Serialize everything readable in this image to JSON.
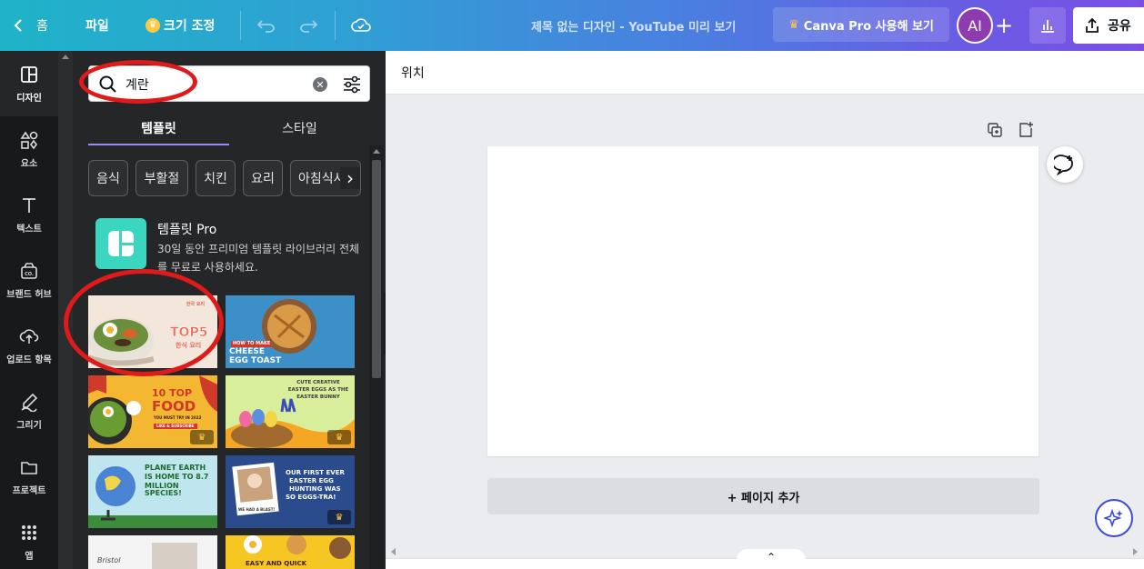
{
  "topbar": {
    "home_label": "홈",
    "file_label": "파일",
    "resize_label": "크기 조정",
    "doc_title": "제목 없는 디자인 - YouTube 미리 보기",
    "pro_label": "Canva Pro 사용해 보기",
    "avatar_initials": "AI",
    "share_label": "공유"
  },
  "rail": {
    "items": [
      {
        "label": "디자인",
        "icon": "layout-icon"
      },
      {
        "label": "요소",
        "icon": "shapes-icon"
      },
      {
        "label": "텍스트",
        "icon": "text-icon"
      },
      {
        "label": "브랜드 허브",
        "icon": "brand-icon"
      },
      {
        "label": "업로드 항목",
        "icon": "upload-icon"
      },
      {
        "label": "그리기",
        "icon": "draw-icon"
      },
      {
        "label": "프로젝트",
        "icon": "folder-icon"
      },
      {
        "label": "앱",
        "icon": "apps-icon"
      }
    ]
  },
  "panel": {
    "search_value": "계란",
    "tabs": [
      "템플릿",
      "스타일"
    ],
    "chips": [
      "음식",
      "부활절",
      "치킨",
      "요리",
      "아침식사"
    ],
    "pro_card": {
      "title": "템플릿 Pro",
      "description": "30일 동안 프리미엄 템플릿 라이브러리 전체를 무료로 사용하세요."
    },
    "templates": [
      {
        "id": "t1",
        "lines": [
          "TOP5"
        ],
        "sub": [
          "한식 요리"
        ]
      },
      {
        "id": "t2",
        "lines": [
          "HOW TO MAKE",
          "CHEESE",
          "EGG TOAST"
        ]
      },
      {
        "id": "t3",
        "lines": [
          "10 TOP",
          "FOOD"
        ],
        "sub": [
          "YOU MUST TRY IN 2023",
          "LIKE & SUBSCRIBE"
        ]
      },
      {
        "id": "t4",
        "lines": [
          "CUTE CREATIVE",
          "EASTER EGGS AS THE",
          "EASTER BUNNY"
        ]
      },
      {
        "id": "t5",
        "lines": [
          "PLANET EARTH",
          "IS HOME TO 8.7",
          "MILLION SPECIES!"
        ]
      },
      {
        "id": "t6",
        "lines": [
          "OUR FIRST EVER",
          "EASTER EGG",
          "HUNTING WAS",
          "SO EGGS-TRA!"
        ],
        "sub": [
          "WE HAD A BLAST!"
        ]
      },
      {
        "id": "t7",
        "lines": [
          "Bristol"
        ]
      },
      {
        "id": "t8",
        "lines": [
          "EASY AND QUICK"
        ]
      }
    ]
  },
  "canvas": {
    "position_label": "위치",
    "add_page_label": "+ 페이지 추가"
  },
  "colors": {
    "accent": "#9b8bf5",
    "annotation": "#e01a1a",
    "pro_teal": "#3ad6c0"
  }
}
